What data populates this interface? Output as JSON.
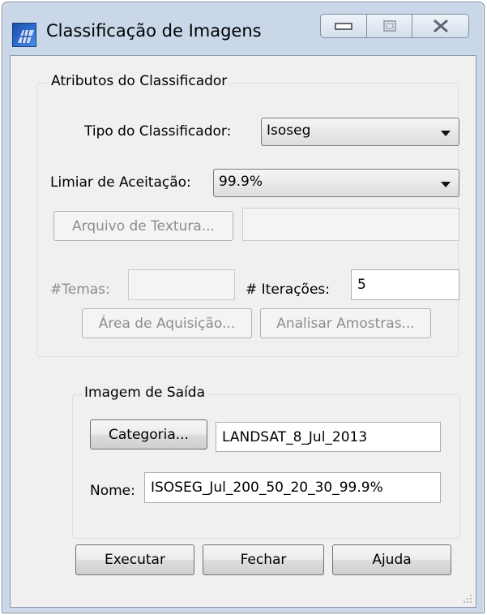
{
  "window": {
    "title": "Classificação de Imagens"
  },
  "attributes_group": {
    "title": "Atributos do Classificador",
    "classifier_type": {
      "label": "Tipo do Classificador:",
      "value": "Isoseg"
    },
    "acceptance_threshold": {
      "label": "Limiar de Aceitação:",
      "value": "99.9%"
    },
    "texture_file": {
      "button_label": "Arquivo de Textura...",
      "value": ""
    },
    "themes": {
      "label": "#Temas:",
      "value": ""
    },
    "iterations": {
      "label": "# Iterações:",
      "value": "5"
    },
    "acquisition_area_label": "Área de Aquisição...",
    "analyze_samples_label": "Analisar Amostras..."
  },
  "output_group": {
    "title": "Imagem de Saída",
    "category_button_label": "Categoria...",
    "category_value": "LANDSAT_8_Jul_2013",
    "name_label": "Nome:",
    "name_value": "ISOSEG_Jul_200_50_20_30_99.9%"
  },
  "footer": {
    "execute_label": "Executar",
    "close_label": "Fechar",
    "help_label": "Ajuda"
  },
  "icons": {
    "app": "classification-app-icon",
    "minimize": "minimize-icon",
    "maximize": "maximize-icon",
    "close": "close-icon",
    "combo_arrow": "chevron-down-icon",
    "resize_grip": "resize-grip-icon"
  }
}
